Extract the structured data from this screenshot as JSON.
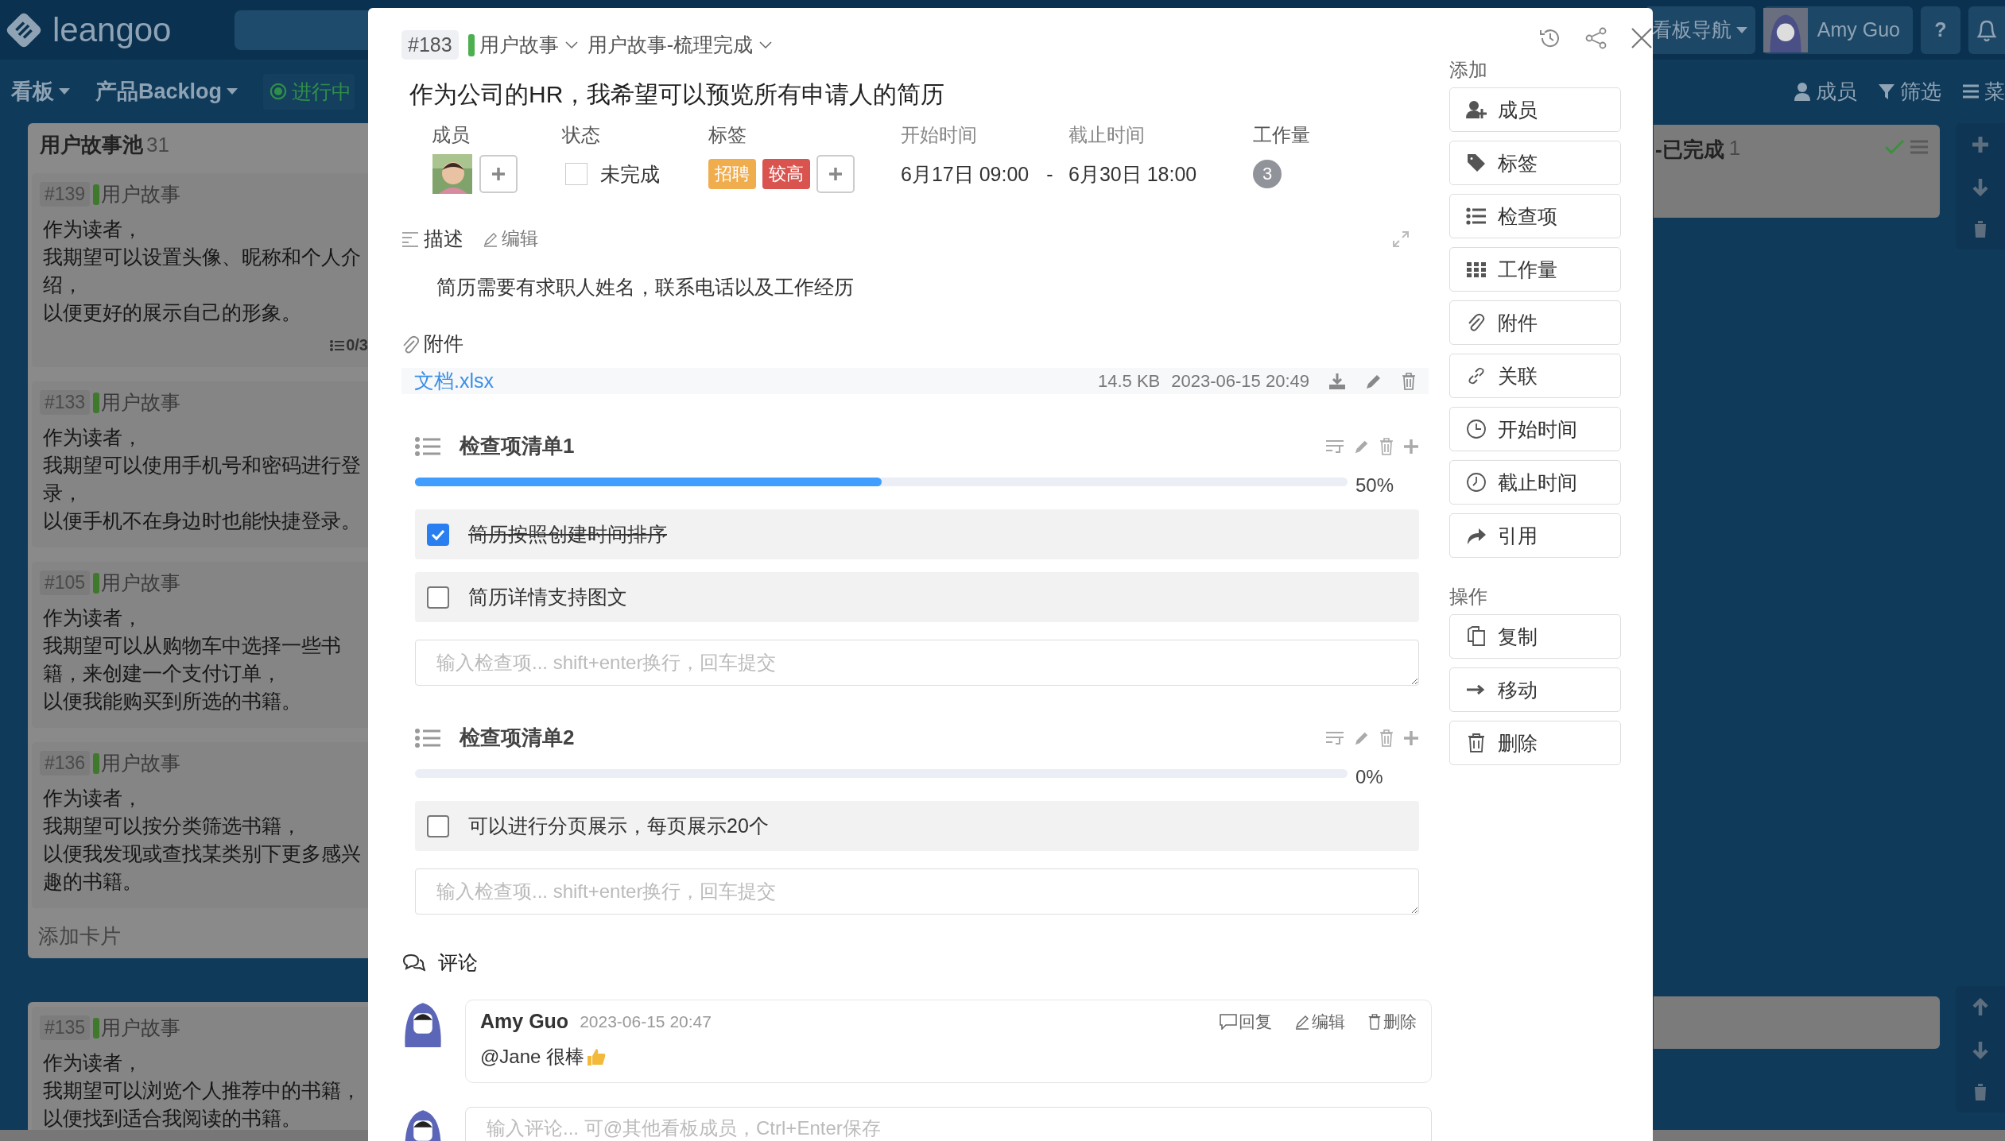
{
  "top_bar": {
    "logo": "leangoo",
    "nav": "看板导航",
    "user": "Amy Guo",
    "help": "?"
  },
  "board_bar": {
    "menus": [
      {
        "label": "看板"
      },
      {
        "label": "产品Backlog"
      }
    ],
    "status": "进行中",
    "actions": [
      {
        "kind": "member",
        "label": "成员"
      },
      {
        "kind": "filter",
        "label": "筛选"
      },
      {
        "kind": "menu",
        "label": "菜"
      }
    ]
  },
  "lists": [
    {
      "title": "用户故事池",
      "count": "31",
      "cards": [
        {
          "id": "#139",
          "type": "用户故事",
          "lines": [
            "作为读者，",
            "我期望可以设置头像、昵称和个人介绍，",
            "以便更好的展示自己的形象。"
          ],
          "checklist": "0/3"
        },
        {
          "id": "#133",
          "type": "用户故事",
          "lines": [
            "作为读者，",
            "我期望可以使用手机号和密码进行登录，",
            "以便手机不在身边时也能快捷登录。"
          ]
        },
        {
          "id": "#105",
          "type": "用户故事",
          "lines": [
            "作为读者，",
            "我期望可以从购物车中选择一些书籍，来创建一个支付订单，",
            "以便我能购买到所选的书籍。"
          ]
        },
        {
          "id": "#136",
          "type": "用户故事",
          "lines": [
            "作为读者，",
            "我期望可以按分类筛选书籍，",
            "以便我发现或查找某类别下更多感兴趣的书籍。"
          ]
        }
      ],
      "add": "添加卡片"
    },
    {
      "cards": [
        {
          "id": "#135",
          "type": "用户故事",
          "lines": [
            "作为读者，",
            "我期望可以浏览个人推荐中的书籍，",
            "以便找到适合我阅读的书籍。"
          ]
        }
      ]
    }
  ],
  "done_list": {
    "title": "-已完成",
    "count": "1"
  },
  "card_detail": {
    "number": "#183",
    "type": "用户故事",
    "stage": "用户故事-梳理完成",
    "title": "作为公司的HR，我希望可以预览所有申请人的简历",
    "fields": {
      "members_label": "成员",
      "status_label": "状态",
      "status": {
        "done": false,
        "text": "未完成"
      },
      "tags_label": "标签",
      "tags": [
        {
          "text": "招聘",
          "color": "#f0ad4e"
        },
        {
          "text": "较高",
          "color": "#d9534f"
        }
      ],
      "start_label": "开始时间",
      "start": "6月17日 09:00",
      "separator": "-",
      "due_label": "截止时间",
      "due": "6月30日 18:00",
      "workload_label": "工作量",
      "workload": "3"
    },
    "description": {
      "heading": "描述",
      "edit": "编辑",
      "text": "简历需要有求职人姓名，联系电话以及工作经历"
    },
    "attachments": {
      "heading": "附件",
      "files": [
        {
          "name": "文档.xlsx",
          "size": "14.5 KB",
          "date": "2023-06-15 20:49"
        }
      ]
    },
    "checklists": [
      {
        "title": "检查项清单1",
        "level": 0.5,
        "percent": "50%",
        "items": [
          {
            "text": "简历按照创建时间排序",
            "checked": true
          },
          {
            "text": "简历详情支持图文",
            "checked": false
          }
        ],
        "placeholder": "输入检查项... shift+enter换行，回车提交"
      },
      {
        "title": "检查项清单2",
        "level": 0,
        "percent": "0%",
        "items": [
          {
            "text": "可以进行分页展示，每页展示20个",
            "checked": false
          }
        ],
        "placeholder": "输入检查项... shift+enter换行，回车提交"
      }
    ],
    "comments": {
      "heading": "评论",
      "items": [
        {
          "author": "Amy Guo",
          "time": "2023-06-15 20:47",
          "text": "@Jane 很棒",
          "actions": [
            {
              "kind": "reply",
              "label": "回复"
            },
            {
              "kind": "edit",
              "label": "编辑"
            },
            {
              "kind": "delete",
              "label": "删除"
            }
          ]
        }
      ],
      "placeholder": "输入评论... 可@其他看板成员，Ctrl+Enter保存"
    },
    "sidebar": [
      {
        "title": "添加",
        "buttons": [
          {
            "kind": "member",
            "label": "成员"
          },
          {
            "kind": "tag",
            "label": "标签"
          },
          {
            "kind": "checklist",
            "label": "检查项"
          },
          {
            "kind": "workload",
            "label": "工作量"
          },
          {
            "kind": "attachment",
            "label": "附件"
          },
          {
            "kind": "link",
            "label": "关联"
          },
          {
            "kind": "start",
            "label": "开始时间"
          },
          {
            "kind": "due",
            "label": "截止时间"
          },
          {
            "kind": "quote",
            "label": "引用"
          }
        ]
      },
      {
        "title": "操作",
        "buttons": [
          {
            "kind": "copy",
            "label": "复制"
          },
          {
            "kind": "move",
            "label": "移动"
          },
          {
            "kind": "delete",
            "label": "删除"
          }
        ]
      }
    ]
  }
}
